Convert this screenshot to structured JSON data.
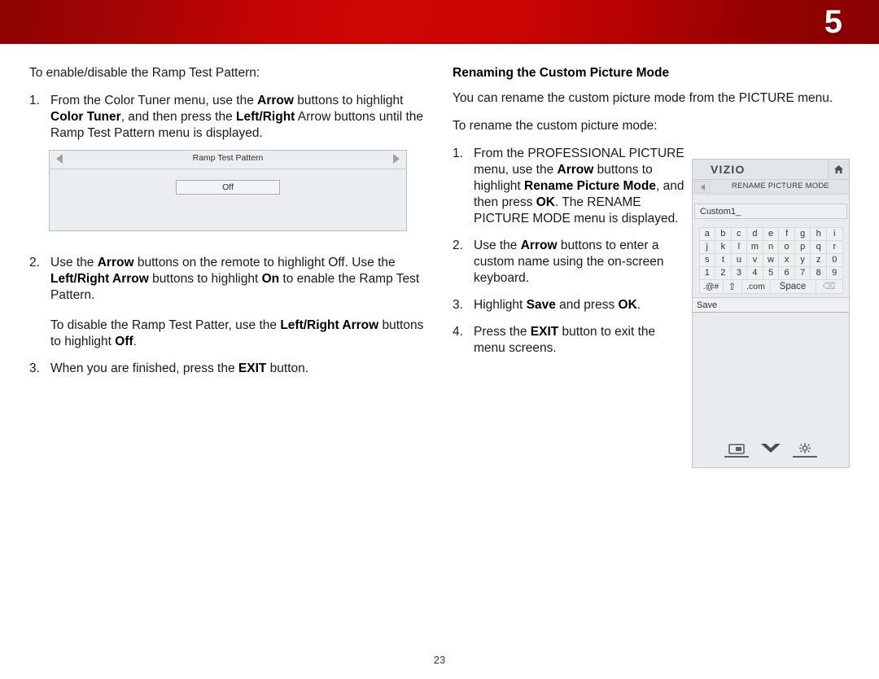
{
  "header": {
    "chapter_number": "5",
    "band_color_dark": "#8d0202",
    "band_color_bright": "#d10606"
  },
  "page": {
    "number": "23"
  },
  "left_column": {
    "intro": "To enable/disable the Ramp Test Pattern:",
    "step1": {
      "num": "1.",
      "part1": "From the Color Tuner menu, use the ",
      "b1": "Arrow",
      "part2": " buttons to highlight ",
      "b2": "Color Tuner",
      "part3": ", and then press the ",
      "b3": "Left/Right",
      "part4": " Arrow buttons until the Ramp Test Pattern menu is displayed."
    },
    "step2": {
      "num": "2.",
      "part1": "Use the ",
      "b1": "Arrow",
      "part2": " buttons on the remote to highlight Off. Use the ",
      "b2": "Left/Right Arrow",
      "part3": " buttons to highlight ",
      "b3": "On",
      "part4": " to enable the Ramp Test Pattern.",
      "sub_part1": "To disable the Ramp Test Patter, use the ",
      "sub_b1": "Left/Right Arrow",
      "sub_part2": " buttons to highlight ",
      "sub_b2": "Off",
      "sub_part3": "."
    },
    "step3": {
      "num": "3.",
      "part1": "When you are finished, press the ",
      "b1": "EXIT",
      "part2": " button."
    }
  },
  "ramp_figure": {
    "title": "Ramp Test Pattern",
    "value_button": "Off",
    "left_arrow_icon": "triangle-left-icon",
    "right_arrow_icon": "triangle-right-icon"
  },
  "right_column": {
    "heading": "Renaming the Custom Picture Mode",
    "paragraph1": "You can rename the custom picture mode from the PICTURE menu.",
    "paragraph2": "To rename the custom picture mode:",
    "step1": {
      "num": "1.",
      "part1": "From the PROFESSIONAL PICTURE menu, use the ",
      "b1": "Arrow",
      "part2": " buttons to highlight ",
      "b2": "Rename Picture Mode",
      "part3": ", and then press ",
      "b3": "OK",
      "part4": ". The RENAME PICTURE MODE menu is displayed."
    },
    "step2": {
      "num": "2.",
      "part1": "Use the ",
      "b1": "Arrow",
      "part2": " buttons to enter a custom name using the on-screen keyboard."
    },
    "step3": {
      "num": "3.",
      "part1": "Highlight ",
      "b1": "Save",
      "part2": " and press ",
      "b2": "OK",
      "part3": "."
    },
    "step4": {
      "num": "4.",
      "part1": "Press the ",
      "b1": "EXIT",
      "part2": " button to exit the menu screens."
    }
  },
  "tv_panel": {
    "brand": "VIZIO",
    "home_icon": "home-icon",
    "back_icon": "triangle-left-icon",
    "menu_title": "RENAME PICTURE MODE",
    "name_value": "Custom1_",
    "keyboard": {
      "rows": [
        [
          "a",
          "b",
          "c",
          "d",
          "e",
          "f",
          "g",
          "h",
          "i"
        ],
        [
          "j",
          "k",
          "l",
          "m",
          "n",
          "o",
          "p",
          "q",
          "r"
        ],
        [
          "s",
          "t",
          "u",
          "v",
          "w",
          "x",
          "y",
          "z",
          "0"
        ],
        [
          "1",
          "2",
          "3",
          "4",
          "5",
          "6",
          "7",
          "8",
          "9"
        ]
      ],
      "special_row": {
        "symbols": ".@#",
        "shift": "⇧",
        "dotcom": ".com",
        "space": "Space",
        "backspace": "⌫"
      }
    },
    "save_label": "Save",
    "footer_icons": [
      "picture-icon",
      "chevron-down-icon",
      "gear-icon"
    ]
  }
}
